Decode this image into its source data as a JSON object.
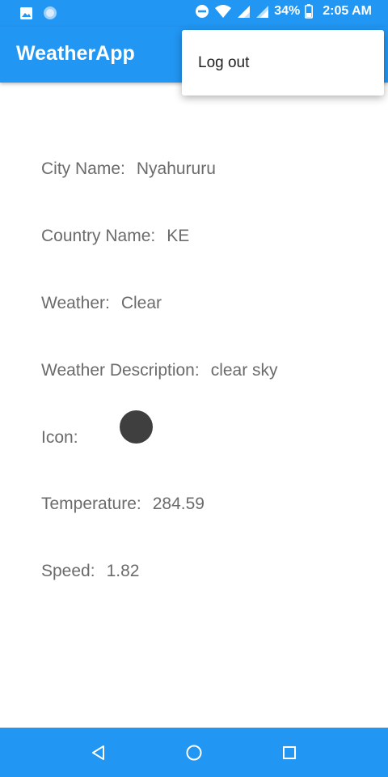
{
  "status_bar": {
    "battery": "34%",
    "time": "2:05 AM",
    "icons": [
      "image-icon",
      "circle-notification-icon",
      "do-not-disturb-icon",
      "wifi-icon",
      "signal-icon",
      "signal-icon",
      "battery-icon"
    ]
  },
  "app_bar": {
    "title": "WeatherApp"
  },
  "overflow_menu": {
    "items": [
      {
        "label": "Log out"
      }
    ]
  },
  "details": {
    "city": {
      "label": "City Name:",
      "value": "Nyahururu"
    },
    "country": {
      "label": "Country Name:",
      "value": "KE"
    },
    "weather": {
      "label": "Weather:",
      "value": "Clear"
    },
    "description": {
      "label": "Weather Description:",
      "value": "clear sky"
    },
    "icon": {
      "label": "Icon:"
    },
    "temperature": {
      "label": "Temperature:",
      "value": "284.59"
    },
    "speed": {
      "label": "Speed:",
      "value": "1.82"
    }
  },
  "nav_bar": {
    "buttons": [
      "back-icon",
      "home-icon",
      "recents-icon"
    ]
  },
  "colors": {
    "primary": "#2196F3",
    "label_text": "#6b6b6b",
    "icon_placeholder": "#3f3f3f"
  }
}
